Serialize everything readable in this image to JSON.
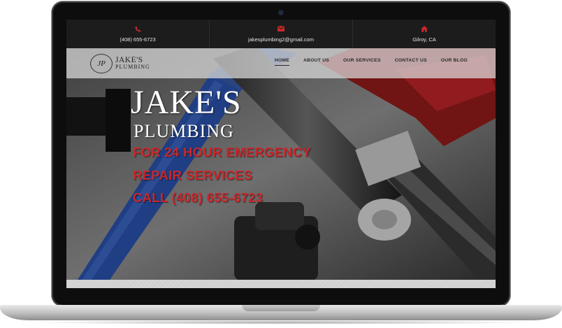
{
  "topbar": {
    "phone": {
      "icon": "phone-icon",
      "text": "(408) 655-6723"
    },
    "email": {
      "icon": "envelope-icon",
      "text": "jakesplumbing2@gmail.com"
    },
    "location": {
      "icon": "home-icon",
      "text": "Gilroy, CA"
    }
  },
  "logo": {
    "mark": "JP",
    "line1": "JAKE'S",
    "line2": "PLUMBING"
  },
  "nav": {
    "items": [
      {
        "label": "HOME"
      },
      {
        "label": "ABOUT US"
      },
      {
        "label": "OUR SERVICES"
      },
      {
        "label": "CONTACT US"
      },
      {
        "label": "OUR BLOG"
      }
    ]
  },
  "hero": {
    "title": "JAKE'S",
    "subtitle": "PLUMBING",
    "line1": "FOR 24 HOUR EMERGENCY",
    "line2": "REPAIR SERVICES",
    "line3": "CALL (408) 655-6723"
  },
  "colors": {
    "accent_red": "#c8282b",
    "wrench_blue": "#2d56b8",
    "topbar_bg": "#1c1c1c"
  }
}
